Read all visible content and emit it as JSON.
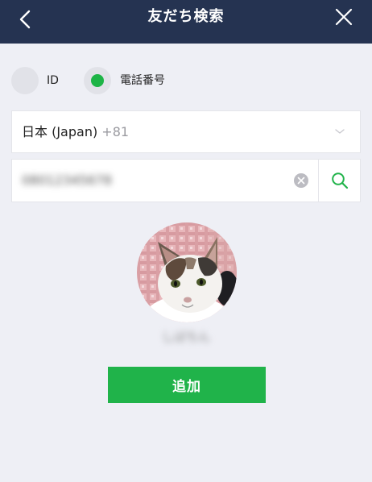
{
  "header": {
    "title": "友だち検索",
    "back_icon": "chevron-left-icon",
    "close_icon": "close-icon",
    "background": "#253351"
  },
  "search_type": {
    "options": [
      {
        "label": "ID",
        "selected": false
      },
      {
        "label": "電話番号",
        "selected": true
      }
    ],
    "accent": "#1db446"
  },
  "country": {
    "name": "日本 (Japan)",
    "code": "+81",
    "dropdown_icon": "chevron-down-icon"
  },
  "phone": {
    "value": "08012345678",
    "clear_icon": "clear-icon",
    "search_icon": "search-icon"
  },
  "result": {
    "avatar": "cat-photo",
    "display_name": "しばちん",
    "add_button_label": "追加",
    "button_color": "#20b34a"
  }
}
